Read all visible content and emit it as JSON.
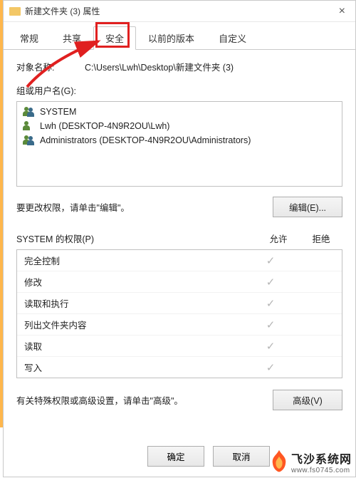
{
  "title": "新建文件夹 (3) 属性",
  "tabs": {
    "general": "常规",
    "share": "共享",
    "security": "安全",
    "prev": "以前的版本",
    "custom": "自定义"
  },
  "object_label": "对象名称:",
  "object_value": "C:\\Users\\Lwh\\Desktop\\新建文件夹 (3)",
  "group_label": "组或用户名(G):",
  "groups": [
    "SYSTEM",
    "Lwh (DESKTOP-4N9R2OU\\Lwh)",
    "Administrators (DESKTOP-4N9R2OU\\Administrators)"
  ],
  "edit_hint": "要更改权限，请单击\"编辑\"。",
  "edit_btn": "编辑(E)...",
  "perm_header_label": "SYSTEM 的权限(P)",
  "perm_allow": "允许",
  "perm_deny": "拒绝",
  "permissions": [
    "完全控制",
    "修改",
    "读取和执行",
    "列出文件夹内容",
    "读取",
    "写入"
  ],
  "adv_hint": "有关特殊权限或高级设置，请单击\"高级\"。",
  "adv_btn": "高级(V)",
  "ok_btn": "确定",
  "cancel_btn": "取消",
  "watermark_title": "飞沙系统网",
  "watermark_url": "www.fs0745.com"
}
